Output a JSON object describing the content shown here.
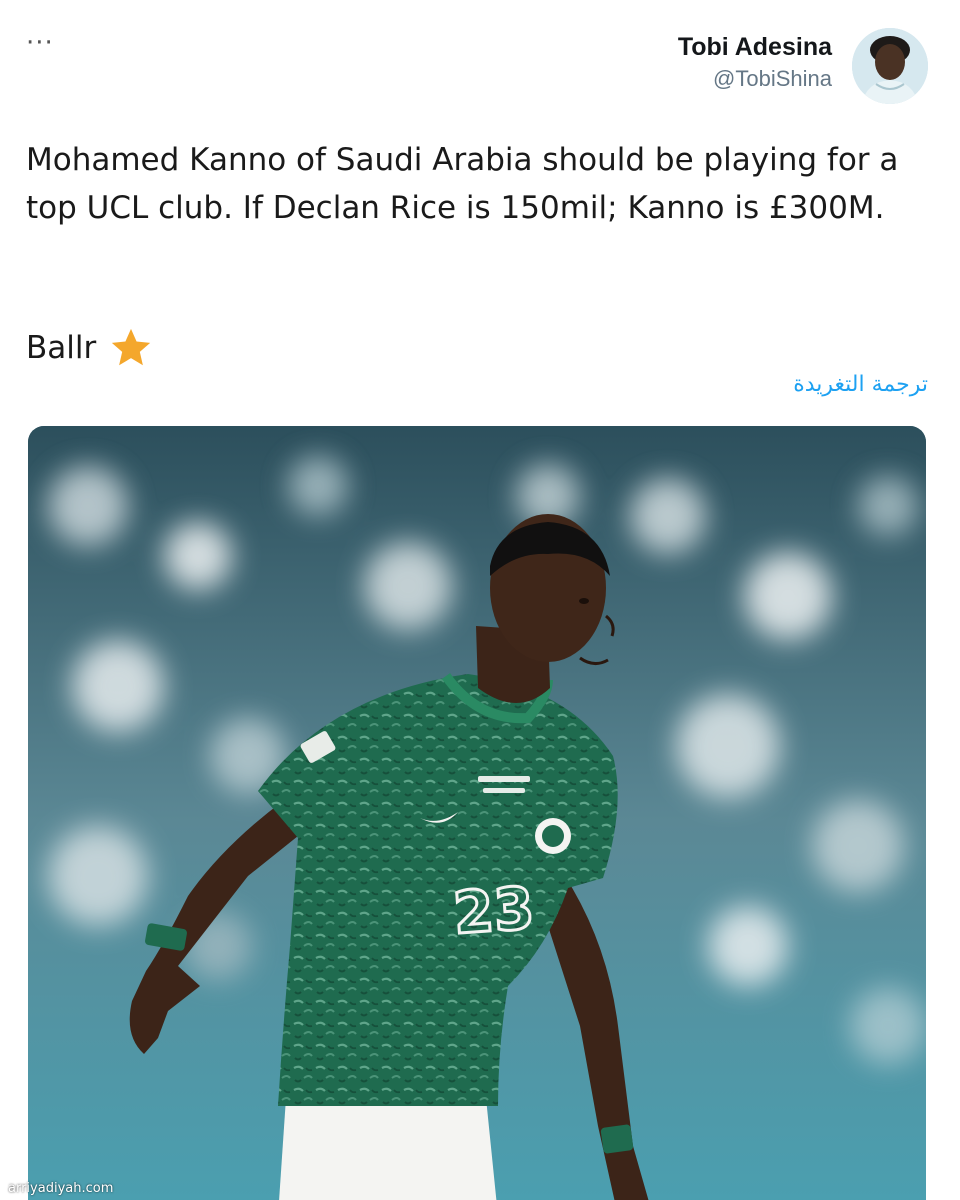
{
  "tweet": {
    "more_label": "···",
    "author_name": "Tobi Adesina",
    "author_handle": "@TobiShina",
    "text": "Mohamed Kanno of Saudi Arabia should be playing for a top UCL club. If Declan Rice is 150mil; Kanno is £300M.",
    "closing_word": "Ballr",
    "closing_icon": "star-icon",
    "translate_label": "ترجمة التغريدة",
    "media": {
      "jersey_number": "23"
    }
  },
  "watermark": "arriyadiyah.com",
  "colors": {
    "link": "#1da1f2",
    "handle": "#657786",
    "jersey_green": "#1f6b4f",
    "star": "#f4a72c"
  }
}
